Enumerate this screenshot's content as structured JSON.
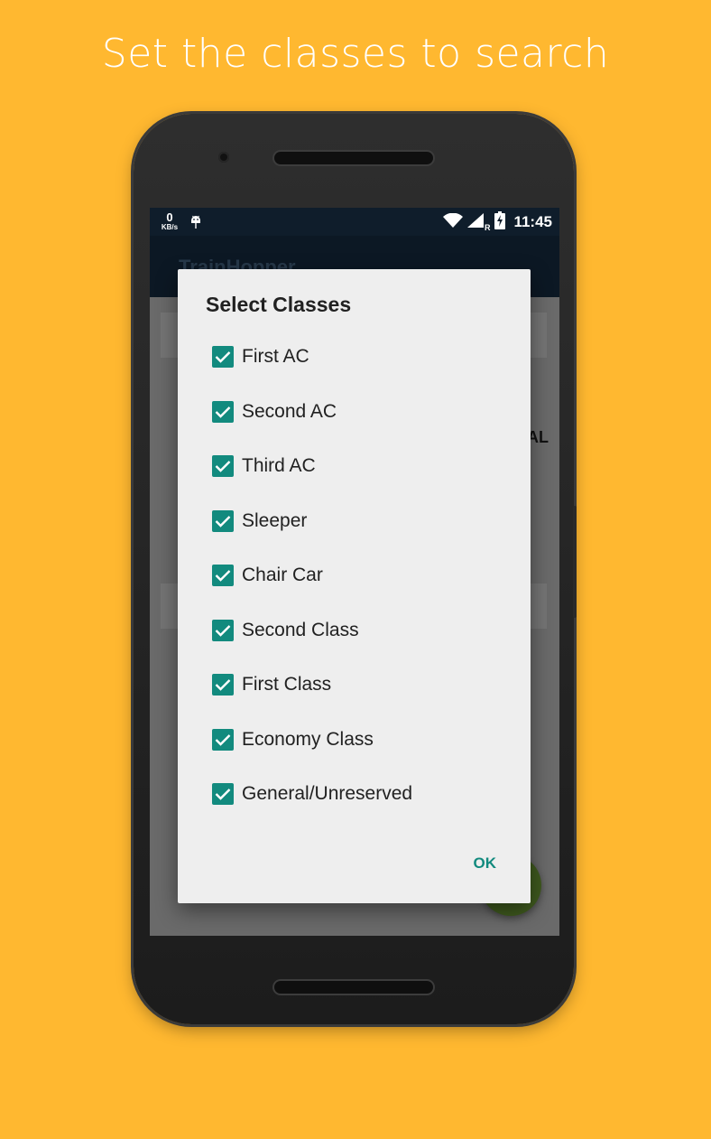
{
  "caption": "Set the classes to search",
  "status_bar": {
    "speed_value": "0",
    "speed_unit": "KB/s",
    "network_label": "R",
    "time": "11:45"
  },
  "app_bar": {
    "title": "TrainHopper"
  },
  "background_text": "AL",
  "dialog": {
    "title": "Select Classes",
    "options": [
      {
        "label": "First AC",
        "checked": true
      },
      {
        "label": "Second AC",
        "checked": true
      },
      {
        "label": "Third AC",
        "checked": true
      },
      {
        "label": "Sleeper",
        "checked": true
      },
      {
        "label": "Chair Car",
        "checked": true
      },
      {
        "label": "Second Class",
        "checked": true
      },
      {
        "label": "First Class",
        "checked": true
      },
      {
        "label": "Economy Class",
        "checked": true
      },
      {
        "label": "General/Unreserved",
        "checked": true
      }
    ],
    "ok_label": "OK"
  },
  "colors": {
    "background": "#FFB830",
    "accent": "#128a7e",
    "status_bar": "#0f1d2b"
  }
}
